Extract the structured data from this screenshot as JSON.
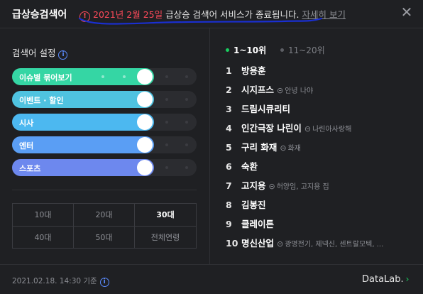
{
  "header": {
    "title": "급상승검색어",
    "notice_icon": "!",
    "notice_date": "2021년 2월 25일",
    "notice_text": " 급상승 검색어 서비스가 종료됩니다.",
    "notice_link": "자세히 보기",
    "close_icon": "✕",
    "scribble_color": "#1a2fd1"
  },
  "settings": {
    "title": "검색어 설정",
    "info_icon": "i",
    "toggles": [
      {
        "label": "이슈별 묶어보기",
        "color": "#35d6a4"
      },
      {
        "label": "이벤트 · 할인",
        "color": "#4fc3e0"
      },
      {
        "label": "시사",
        "color": "#4cb8f0"
      },
      {
        "label": "엔터",
        "color": "#5a9ef4"
      },
      {
        "label": "스포츠",
        "color": "#6d88ee"
      }
    ],
    "ages": [
      "10대",
      "20대",
      "30대",
      "40대",
      "50대",
      "전체연령"
    ],
    "active_age": "30대"
  },
  "tabs": [
    {
      "label": "1~10위",
      "active": true
    },
    {
      "label": "11~20위",
      "active": false
    }
  ],
  "ranking": [
    {
      "rank": "1",
      "keyword": "방용훈",
      "related": ""
    },
    {
      "rank": "2",
      "keyword": "시지프스",
      "related": "안녕 나야"
    },
    {
      "rank": "3",
      "keyword": "드림시큐리티",
      "related": ""
    },
    {
      "rank": "4",
      "keyword": "인간극장 나린이",
      "related": "나린아사랑해"
    },
    {
      "rank": "5",
      "keyword": "구리 화재",
      "related": "화재"
    },
    {
      "rank": "6",
      "keyword": "숙환",
      "related": ""
    },
    {
      "rank": "7",
      "keyword": "고지용",
      "related": "허양임, 고지용 집"
    },
    {
      "rank": "8",
      "keyword": "김봉진",
      "related": ""
    },
    {
      "rank": "9",
      "keyword": "클레이튼",
      "related": ""
    },
    {
      "rank": "10",
      "keyword": "명신산업",
      "related": "광명전기, 제넥신, 센트랄모텍, ..."
    }
  ],
  "footer": {
    "timestamp": "2021.02.18. 14:30 기준",
    "info_icon": "i",
    "brand": "DataLab.",
    "arrow_icon": "›"
  }
}
